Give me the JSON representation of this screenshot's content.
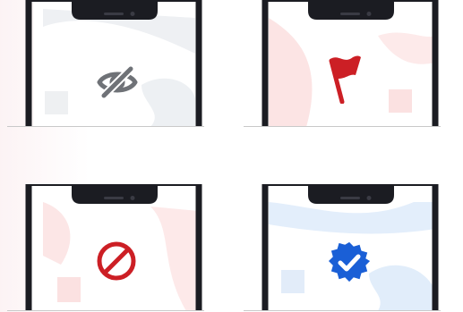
{
  "tiles": [
    {
      "id": "hidden",
      "icon": "eye-off-icon",
      "icon_color": "#6f7277",
      "accent": "#e7eaee"
    },
    {
      "id": "flagged",
      "icon": "flag-icon",
      "icon_color": "#cc1f25",
      "accent": "#fbe0e0"
    },
    {
      "id": "blocked",
      "icon": "block-icon",
      "icon_color": "#cc1f25",
      "accent": "#fbe0e0"
    },
    {
      "id": "verified",
      "icon": "verified-badge-icon",
      "icon_color": "#1a5fd6",
      "accent": "#ddebfa"
    }
  ],
  "colors": {
    "phone_frame": "#1b1c22",
    "screen": "#ffffff",
    "baseline": "#c9c9c9",
    "page_tint": "#fdf0f1"
  }
}
